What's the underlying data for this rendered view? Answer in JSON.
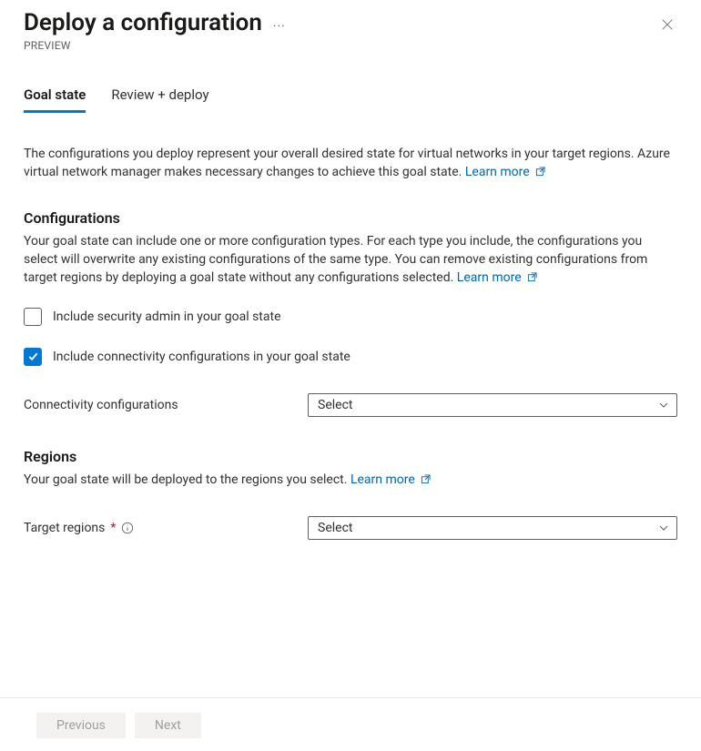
{
  "header": {
    "title": "Deploy a configuration",
    "preview_label": "PREVIEW"
  },
  "tabs": {
    "goal_state": "Goal state",
    "review_deploy": "Review + deploy"
  },
  "intro": {
    "text": "The configurations you deploy represent your overall desired state for virtual networks in your target regions. Azure virtual network manager makes necessary changes to achieve this goal state.",
    "learn_more": "Learn more"
  },
  "configs": {
    "heading": "Configurations",
    "desc": "Your goal state can include one or more configuration types. For each type you include, the configurations you select will overwrite any existing configurations of the same type. You can remove existing configurations from target regions by deploying a goal state without any configurations selected.",
    "learn_more": "Learn more",
    "cb_security": "Include security admin in your goal state",
    "cb_connectivity": "Include connectivity configurations in your goal state",
    "conn_label": "Connectivity configurations",
    "conn_select": "Select"
  },
  "regions": {
    "heading": "Regions",
    "desc": "Your goal state will be deployed to the regions you select.",
    "learn_more": "Learn more",
    "target_label": "Target regions",
    "target_select": "Select"
  },
  "footer": {
    "previous": "Previous",
    "next": "Next"
  }
}
